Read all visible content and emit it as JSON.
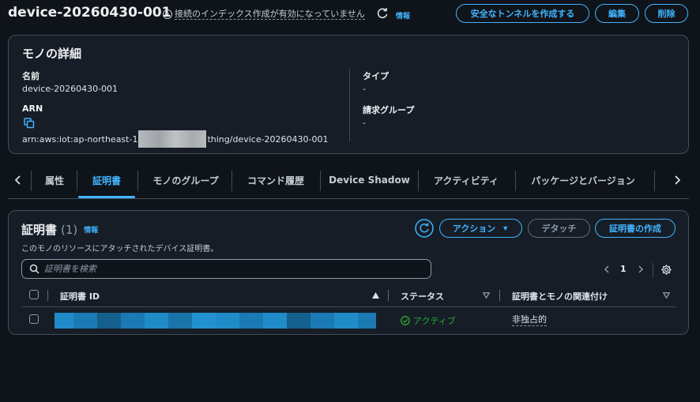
{
  "header": {
    "title": "device-20260430-001",
    "index_status": "接続のインデックス作成が有効になっていません",
    "info": "情報",
    "buttons": {
      "create_tunnel": "安全なトンネルを作成する",
      "edit": "編集",
      "delete": "削除"
    }
  },
  "details": {
    "title": "モノの詳細",
    "name_label": "名前",
    "name_value": "device-20260430-001",
    "arn_label": "ARN",
    "arn_prefix": "arn:aws:iot:ap-northeast-1",
    "arn_suffix": "thing/device-20260430-001",
    "type_label": "タイプ",
    "type_value": "-",
    "billing_label": "請求グループ",
    "billing_value": "-"
  },
  "tabs": [
    {
      "label": "属性"
    },
    {
      "label": "証明書"
    },
    {
      "label": "モノのグループ"
    },
    {
      "label": "コマンド履歴"
    },
    {
      "label": "Device Shadow"
    },
    {
      "label": "アクティビティ"
    },
    {
      "label": "パッケージとバージョン"
    }
  ],
  "certificates": {
    "title": "証明書",
    "count": "(1)",
    "info": "情報",
    "description": "このモノのリソースにアタッチされたデバイス証明書。",
    "actions_label": "アクション",
    "detach_label": "デタッチ",
    "create_label": "証明書の作成",
    "search_placeholder": "証明書を検索",
    "page": "1",
    "columns": [
      "証明書 ID",
      "ステータス",
      "証明書とモノの関連付け"
    ],
    "rows": [
      {
        "status": "アクティブ",
        "association": "非独占的"
      }
    ]
  },
  "colors": {
    "accent": "#42b4ff",
    "success": "#29ad32",
    "background": "#0f141a",
    "card": "#161d26"
  }
}
